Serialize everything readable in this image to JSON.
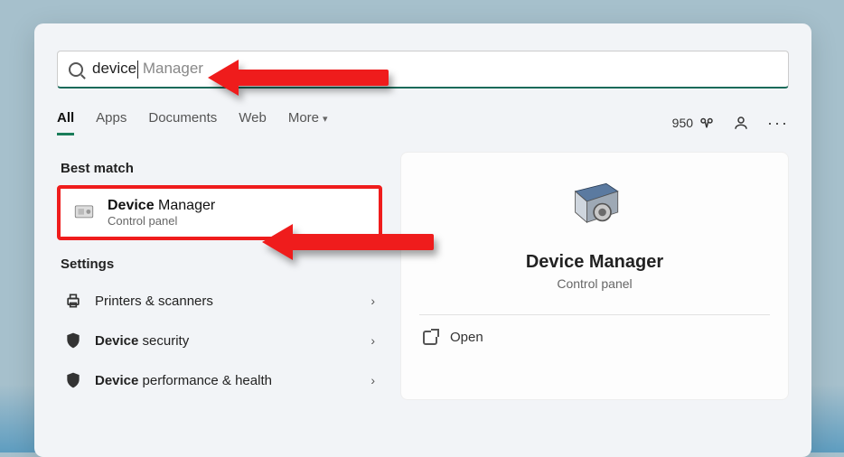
{
  "search": {
    "typed": "device",
    "suggestion": " Manager"
  },
  "tabs": {
    "items": [
      "All",
      "Apps",
      "Documents",
      "Web",
      "More"
    ],
    "active_index": 0
  },
  "toolbar": {
    "points": "950"
  },
  "sections": {
    "best_match_label": "Best match",
    "settings_label": "Settings"
  },
  "best_match": {
    "title_bold": "Device",
    "title_rest": " Manager",
    "subtitle": "Control panel"
  },
  "settings_items": [
    {
      "label_plain": "Printers & scanners",
      "label_bold": ""
    },
    {
      "label_bold": "Device",
      "label_plain": " security"
    },
    {
      "label_bold": "Device",
      "label_plain": " performance & health"
    }
  ],
  "detail": {
    "title": "Device Manager",
    "subtitle": "Control panel",
    "open_label": "Open"
  }
}
